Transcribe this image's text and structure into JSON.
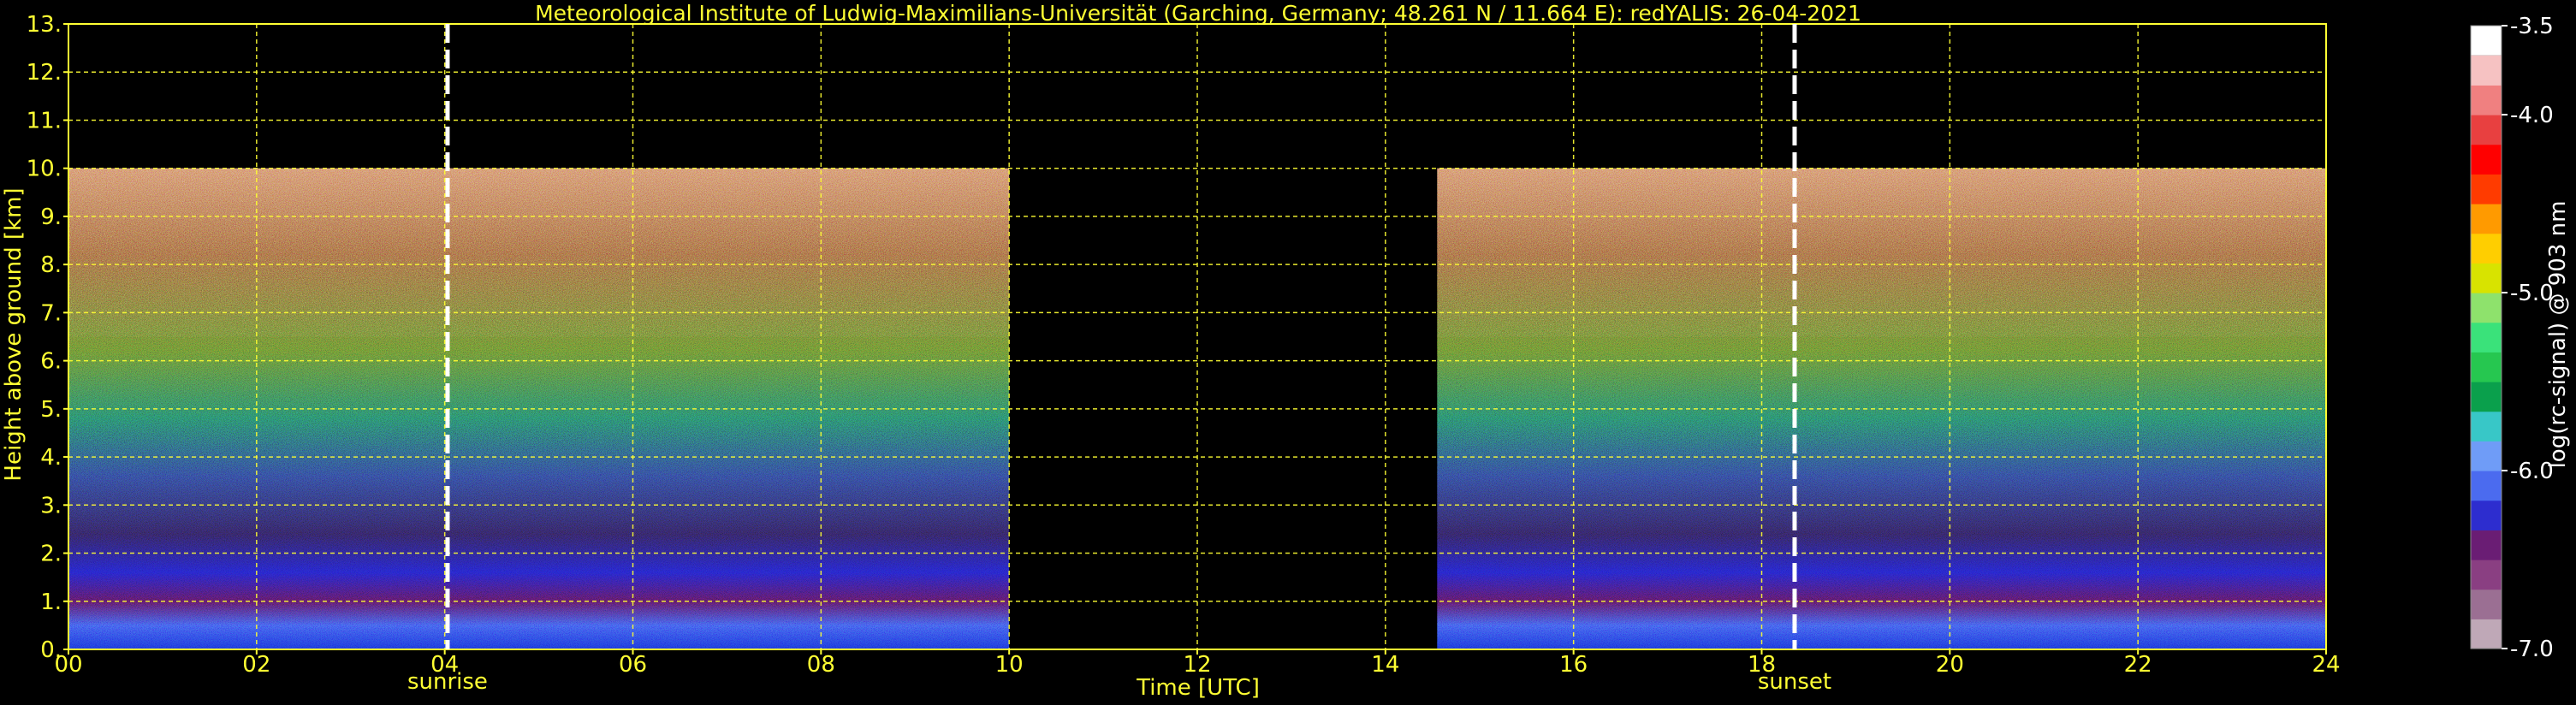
{
  "chart_data": {
    "type": "heatmap",
    "title": "Meteorological Institute of Ludwig-Maximilians-Universität (Garching, Germany; 48.261 N / 11.664 E):    redYALIS: 26-04-2021",
    "xlabel": "Time [UTC]",
    "ylabel": "Height above ground [km]",
    "xlim": [
      0,
      24
    ],
    "ylim": [
      0,
      13
    ],
    "x_ticks": [
      "00",
      "02",
      "04",
      "06",
      "08",
      "10",
      "12",
      "14",
      "16",
      "18",
      "20",
      "22",
      "24"
    ],
    "y_ticks": [
      "0.",
      "1.",
      "2.",
      "3.",
      "4.",
      "5.",
      "6.",
      "7.",
      "8.",
      "9.",
      "10.",
      "11.",
      "12.",
      "13."
    ],
    "grid": true,
    "measurement_max_height_km": 10,
    "data_segments": [
      {
        "start": 0.0,
        "end": 10.0
      },
      {
        "start": 14.55,
        "end": 24.0
      }
    ],
    "events": [
      {
        "label": "sunrise",
        "time": 4.03
      },
      {
        "label": "sunset",
        "time": 18.35
      }
    ],
    "colorbar": {
      "label": "log(rc-signal) @ 903 nm",
      "range": [
        -7.0,
        -3.5
      ],
      "ticks": [
        "-3.5",
        "-4.0",
        "-5.0",
        "-6.0",
        "-7.0"
      ],
      "colors": [
        "#bfa8b7",
        "#9b6f93",
        "#8a3f82",
        "#6a1d74",
        "#2d2dcf",
        "#4b6bef",
        "#6f9cf7",
        "#38c7c7",
        "#0aa04c",
        "#26c750",
        "#3ae27a",
        "#8ee26c",
        "#d8e300",
        "#ffce00",
        "#ff9a00",
        "#ff3b00",
        "#ff0000",
        "#e84040",
        "#f08080",
        "#f6c2c2",
        "#ffffff"
      ]
    }
  }
}
